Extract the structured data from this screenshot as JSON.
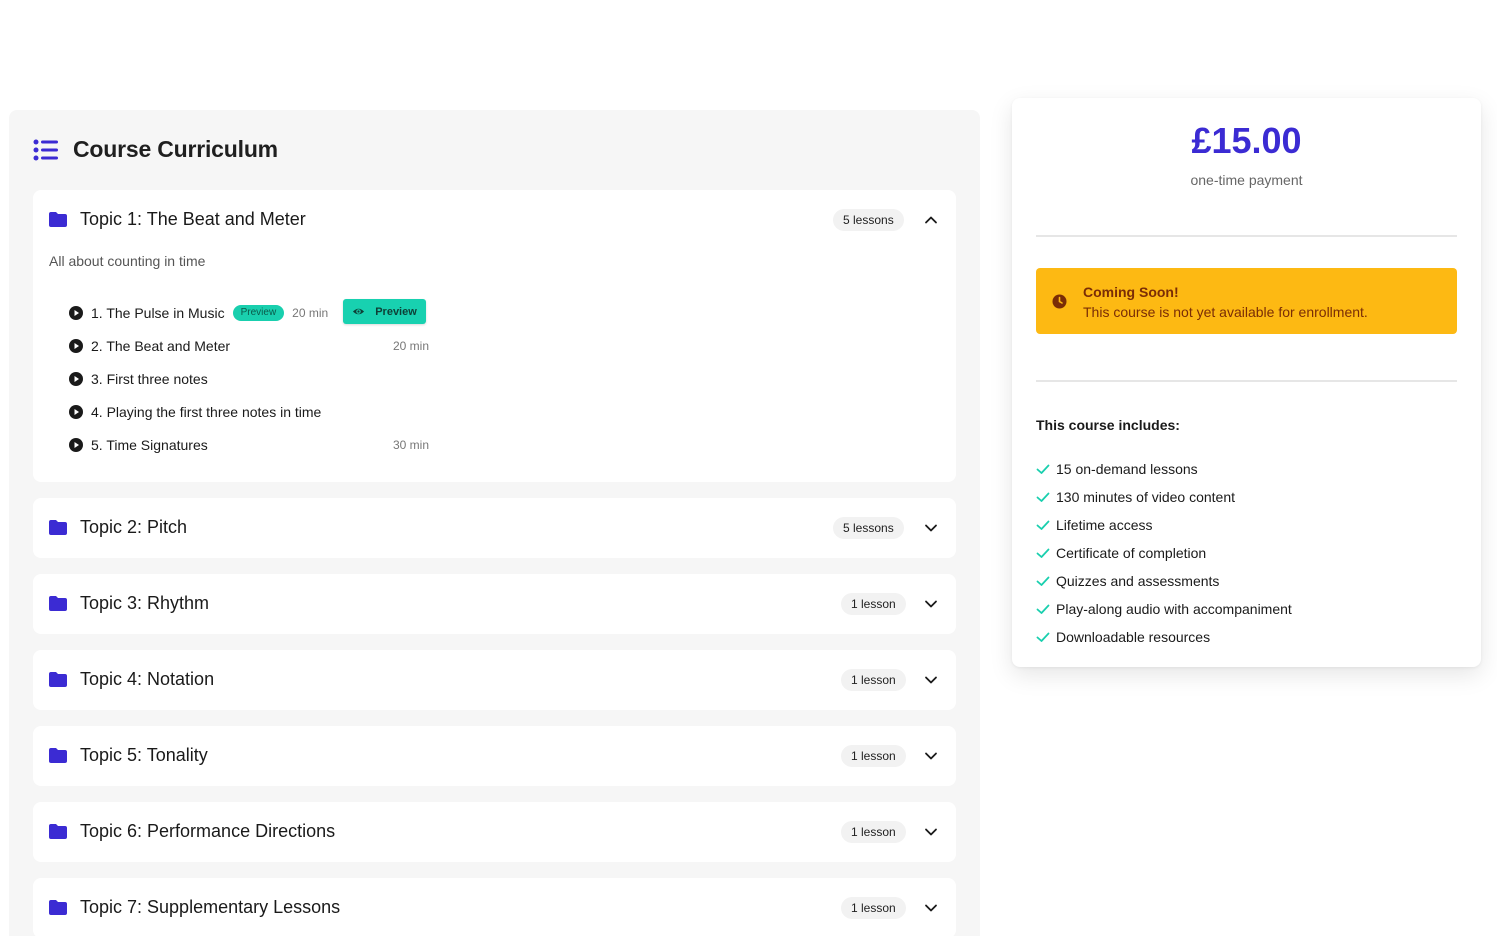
{
  "curriculum": {
    "title": "Course Curriculum",
    "topics": [
      {
        "title": "Topic 1: The Beat and Meter",
        "count": "5 lessons",
        "expanded": true,
        "description": "All about counting in time",
        "lessons": [
          {
            "title": "1. The Pulse in Music",
            "tag": "Preview",
            "duration": "20 min",
            "button": "Preview"
          },
          {
            "title": "2. The Beat and Meter",
            "duration": "20 min"
          },
          {
            "title": "3. First three notes"
          },
          {
            "title": "4. Playing the first three notes in time"
          },
          {
            "title": "5. Time Signatures",
            "duration": "30 min"
          }
        ]
      },
      {
        "title": "Topic 2: Pitch",
        "count": "5 lessons",
        "expanded": false
      },
      {
        "title": "Topic 3: Rhythm",
        "count": "1 lesson",
        "expanded": false
      },
      {
        "title": "Topic 4: Notation",
        "count": "1 lesson",
        "expanded": false
      },
      {
        "title": "Topic 5: Tonality",
        "count": "1 lesson",
        "expanded": false
      },
      {
        "title": "Topic 6: Performance Directions",
        "count": "1 lesson",
        "expanded": false
      },
      {
        "title": "Topic 7: Supplementary Lessons",
        "count": "1 lesson",
        "expanded": false
      }
    ]
  },
  "pricing": {
    "price": "£15.00",
    "price_note": "one-time payment",
    "notice_title": "Coming Soon!",
    "notice_text": "This course is not yet available for enrollment.",
    "includes_title": "This course includes:",
    "includes": [
      "15 on-demand lessons",
      "130 minutes of video content",
      "Lifetime access",
      "Certificate of completion",
      "Quizzes and assessments",
      "Play-along audio with accompaniment",
      "Downloadable resources"
    ]
  },
  "colors": {
    "accent": "#3b2bd3",
    "teal": "#18d1b0",
    "warning": "#fdb913",
    "check": "#19cfae"
  },
  "icons": [
    "list-icon",
    "folder-icon",
    "chevron-up-icon",
    "chevron-down-icon",
    "play-icon",
    "eye-icon",
    "clock-icon",
    "check-icon"
  ]
}
